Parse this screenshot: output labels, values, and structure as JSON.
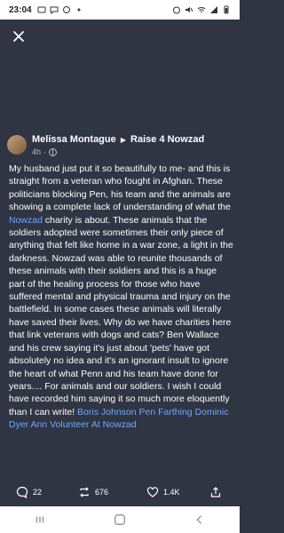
{
  "status_bar": {
    "time": "23:04"
  },
  "post": {
    "author": "Melissa Montague",
    "group": "Raise 4 Nowzad",
    "time_ago": "4h",
    "body_segments": [
      {
        "text": "My husband just put it so beautifully to me- and this is straight from a veteran who fought in Afghan. These politicians blocking Pen, his team and the animals are showing a complete lack of understanding of what the ",
        "link": false
      },
      {
        "text": "Nowzad",
        "link": true
      },
      {
        "text": " charity is about. These animals that the soldiers adopted were sometimes their only piece of anything that felt like home in a war zone, a light in the darkness. Nowzad was able to reunite thousands of these animals with their soldiers and this is a huge part of the healing process for those who have suffered mental and physical trauma and injury on the battlefield. In some cases these animals will literally have saved their lives. Why do we have charities here that link veterans with dogs and cats? Ben Wallace and his crew saying it's just about 'pets' have got absolutely no idea and it's an ignorant insult to ignore the heart of what Penn and his team have done for years.... For animals and our soldiers. I wish I could have recorded him saying it so much more eloquently than I can write! ",
        "link": false
      },
      {
        "text": "Boris Johnson Pen Farthing Dominic Dyer Ann Volunteer At Nowzad",
        "link": true
      }
    ]
  },
  "actions": {
    "comments": "22",
    "shares": "676",
    "reactions": "1.4K"
  },
  "colors": {
    "background": "#2f3542",
    "link": "#6fa8ff"
  }
}
